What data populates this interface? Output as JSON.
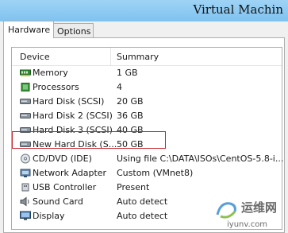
{
  "window": {
    "title": "Virtual Machin"
  },
  "tabs": [
    {
      "label": "Hardware",
      "active": true
    },
    {
      "label": "Options",
      "active": false
    }
  ],
  "table": {
    "columns": [
      "Device",
      "Summary"
    ],
    "rows": [
      {
        "device": "Memory",
        "summary": "1 GB",
        "icon": "memory-icon"
      },
      {
        "device": "Processors",
        "summary": "4",
        "icon": "processor-icon"
      },
      {
        "device": "Hard Disk (SCSI)",
        "summary": "20 GB",
        "icon": "hard-disk-icon"
      },
      {
        "device": "Hard Disk 2 (SCSI)",
        "summary": "36 GB",
        "icon": "hard-disk-icon"
      },
      {
        "device": "Hard Disk 3 (SCSI)",
        "summary": "40 GB",
        "icon": "hard-disk-icon"
      },
      {
        "device": "New Hard Disk (S...",
        "summary": "50 GB",
        "icon": "hard-disk-icon",
        "highlighted": true
      },
      {
        "device": "CD/DVD (IDE)",
        "summary": "Using file C:\\DATA\\ISOs\\CentOS-5.8-i...",
        "icon": "cd-dvd-icon"
      },
      {
        "device": "Network Adapter",
        "summary": "Custom (VMnet8)",
        "icon": "network-adapter-icon"
      },
      {
        "device": "USB Controller",
        "summary": "Present",
        "icon": "usb-controller-icon"
      },
      {
        "device": "Sound Card",
        "summary": "Auto detect",
        "icon": "sound-card-icon"
      },
      {
        "device": "Display",
        "summary": "Auto detect",
        "icon": "display-icon"
      }
    ]
  },
  "watermark": {
    "text_cn": "运维网",
    "url": "iyunv.com"
  },
  "colors": {
    "highlight": "#c4262e",
    "titlebar": "#8ccaf2"
  }
}
